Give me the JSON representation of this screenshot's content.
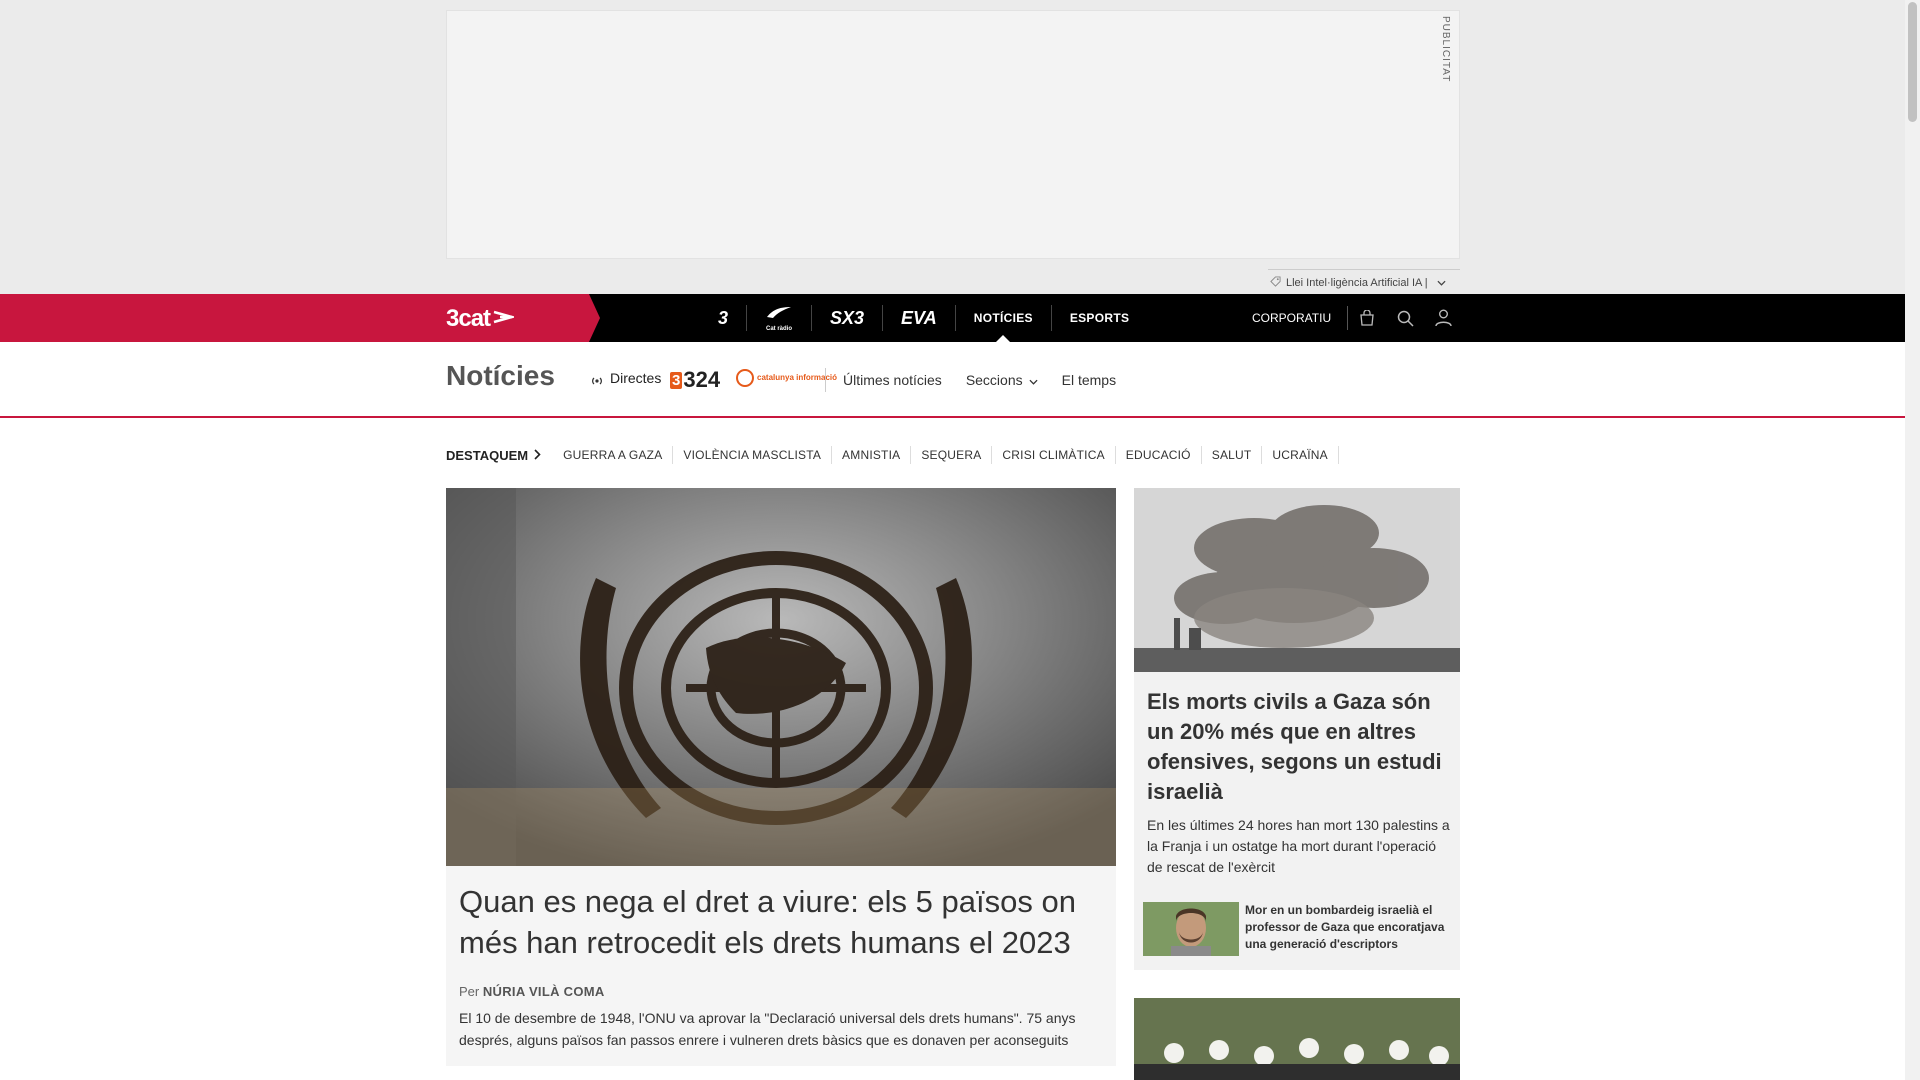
{
  "ad": {
    "label": "PUBLICITAT",
    "ai_note": "Llei Intel·ligència Artificial IA |"
  },
  "topbar": {
    "brand": "3cat",
    "channels": [
      {
        "label": "3",
        "kind": "logo"
      },
      {
        "label": "Cat ràdio",
        "kind": "logo"
      },
      {
        "label": "SX3",
        "kind": "logo"
      },
      {
        "label": "EVA",
        "kind": "logo"
      },
      {
        "label": "NOTÍCIES",
        "kind": "text",
        "active": true
      },
      {
        "label": "ESPORTS",
        "kind": "text"
      }
    ],
    "corporate_label": "CORPORATIU",
    "icons": [
      "shopping-bag-icon",
      "search-icon",
      "user-icon"
    ]
  },
  "section": {
    "title": "Notícies",
    "live_label": "Directes",
    "logo_324": "324",
    "logo_ci": "catalunya informació",
    "nav": [
      {
        "label": "Últimes notícies"
      },
      {
        "label": "Seccions",
        "dropdown": true
      },
      {
        "label": "El temps"
      }
    ]
  },
  "destaquem": {
    "label": "DESTAQUEM",
    "links": [
      "GUERRA A GAZA",
      "VIOLÈNCIA MASCLISTA",
      "AMNISTIA",
      "SEQUERA",
      "CRISI CLIMÀTICA",
      "EDUCACIÓ",
      "SALUT",
      "UCRAÏNA"
    ]
  },
  "main_article": {
    "title": "Quan es nega el dret a viure: els 5 països on més han retrocedit els drets humans el 2023",
    "byline_prefix": "Per",
    "author": "NÚRIA VILÀ COMA",
    "summary": "El 10 de desembre de 1948, l'ONU va aprovar la \"Declaració universal dels drets humans\". 75 anys després, alguns països fan passos enrere i vulneren drets bàsics que es donaven per aconseguits"
  },
  "side_article": {
    "title": "Els morts civils a Gaza són un 20% més que en altres ofensives, segons un estudi israelià",
    "summary": "En les últimes 24 hores han mort 130 palestins a la Franja i un ostatge ha mort durant l'operació de rescat de l'exèrcit",
    "related_title": "Mor en un bombardeig israelià el professor de Gaza que encoratjava una generació d'escriptors"
  },
  "colors": {
    "brand": "#c8163e",
    "topbar": "#000000",
    "accent_324": "#e65a1a"
  }
}
